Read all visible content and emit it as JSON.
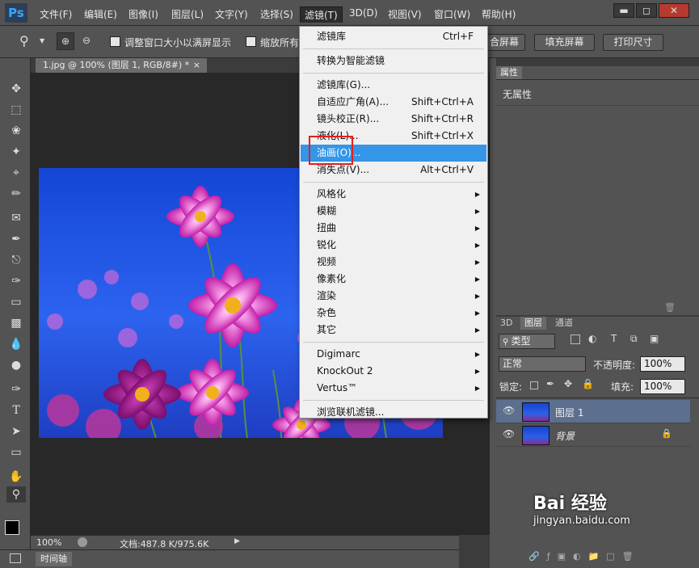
{
  "app": {
    "logo": "Ps"
  },
  "menubar": {
    "items": [
      "文件(F)",
      "编辑(E)",
      "图像(I)",
      "图层(L)",
      "文字(Y)",
      "选择(S)",
      "滤镜(T)",
      "3D(D)",
      "视图(V)",
      "窗口(W)",
      "帮助(H)"
    ],
    "active": "滤镜(T)"
  },
  "window_controls": {
    "minimize": "▬",
    "maximize": "◻",
    "close": "✕"
  },
  "options": {
    "checkbox1_label": "调整窗口大小以满屏显示",
    "checkbox2_label": "缩放所有",
    "btn_fit": "合屏幕",
    "btn_fill": "填充屏幕",
    "btn_print": "打印尺寸"
  },
  "document": {
    "tab_title": "1.jpg @ 100% (图层 1, RGB/8#) *",
    "tab_close": "×"
  },
  "status": {
    "zoom": "100%",
    "doc_info": "文档:487.8 K/975.6K"
  },
  "timeline": {
    "label": "时间轴"
  },
  "properties": {
    "tab": "属性",
    "empty_text": "无属性"
  },
  "layers_panel": {
    "tabs": [
      "3D",
      "图层",
      "通道"
    ],
    "filter_kind": "类型",
    "blend_mode": "正常",
    "opacity_label": "不透明度:",
    "opacity_value": "100%",
    "lock_label": "锁定:",
    "fill_label": "填充:",
    "fill_value": "100%",
    "layers": [
      {
        "name": "图层 1",
        "selected": true
      },
      {
        "name": "背景",
        "selected": false,
        "italic": true
      }
    ]
  },
  "filter_menu": {
    "items": [
      {
        "label": "滤镜库",
        "shortcut": "Ctrl+F"
      },
      {
        "sep": true
      },
      {
        "label": "转换为智能滤镜"
      },
      {
        "sep": true
      },
      {
        "label": "滤镜库(G)..."
      },
      {
        "label": "自适应广角(A)...",
        "shortcut": "Shift+Ctrl+A"
      },
      {
        "label": "镜头校正(R)...",
        "shortcut": "Shift+Ctrl+R"
      },
      {
        "label": "液化(L)...",
        "shortcut": "Shift+Ctrl+X"
      },
      {
        "label": "油画(O)...",
        "highlighted": true
      },
      {
        "label": "消失点(V)...",
        "shortcut": "Alt+Ctrl+V"
      },
      {
        "sep": true
      },
      {
        "label": "风格化",
        "submenu": true
      },
      {
        "label": "模糊",
        "submenu": true
      },
      {
        "label": "扭曲",
        "submenu": true
      },
      {
        "label": "锐化",
        "submenu": true
      },
      {
        "label": "视频",
        "submenu": true
      },
      {
        "label": "像素化",
        "submenu": true
      },
      {
        "label": "渲染",
        "submenu": true
      },
      {
        "label": "杂色",
        "submenu": true
      },
      {
        "label": "其它",
        "submenu": true
      },
      {
        "sep": true
      },
      {
        "label": "Digimarc",
        "submenu": true
      },
      {
        "label": "KnockOut 2",
        "submenu": true
      },
      {
        "label": "Vertus™",
        "submenu": true
      },
      {
        "sep": true
      },
      {
        "label": "浏览联机滤镜..."
      }
    ]
  },
  "watermark": {
    "text": "Bai 经验",
    "url": "jingyan.baidu.com"
  },
  "colors": {
    "menu_highlight": "#3595e6",
    "annotation_box": "#e02020",
    "panel_bg": "#535353",
    "canvas_bg": "#282828"
  }
}
